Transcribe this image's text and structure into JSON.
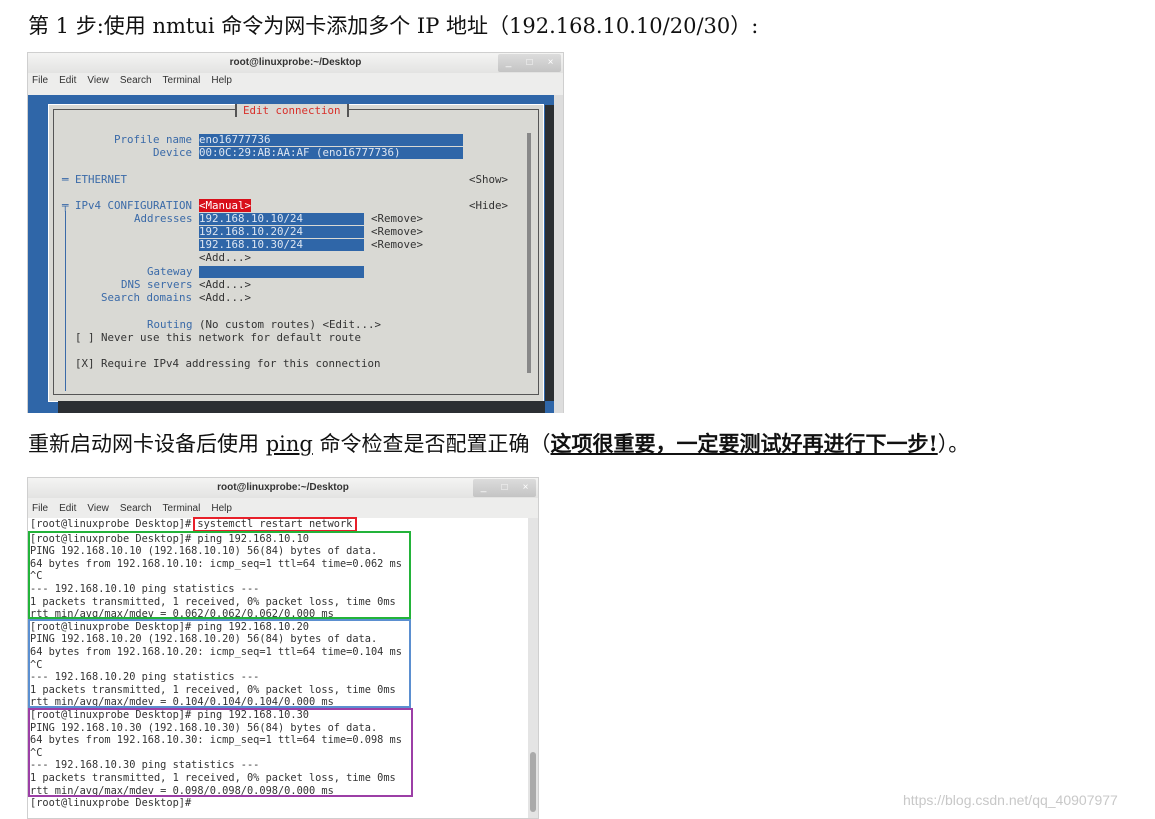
{
  "heading1": "第 1 步:使用 nmtui 命令为网卡添加多个 IP 地址（192.168.10.10/20/30）:",
  "para2": {
    "prefix": "重新启动网卡设备后使用 ",
    "ping": "ping",
    "middle": " 命令检查是否配置正确（",
    "emph": "这项很重要，一定要测试好再进行下一步!",
    "suffix": "）。"
  },
  "window1": {
    "title": "root@linuxprobe:~/Desktop",
    "menu": [
      "File",
      "Edit",
      "View",
      "Search",
      "Terminal",
      "Help"
    ],
    "dialog_title": "Edit connection",
    "profile_label": "Profile name",
    "profile_value": "eno16777736",
    "device_label": "Device",
    "device_value": "00:0C:29:AB:AA:AF (eno16777736)",
    "ethernet": "═ ETHERNET",
    "show": "<Show>",
    "ipv4": "╤ IPv4 CONFIGURATION",
    "ipv4_mode": "<Manual>",
    "hide": "<Hide>",
    "addresses_label": "Addresses",
    "addresses": [
      "192.168.10.10/24",
      "192.168.10.20/24",
      "192.168.10.30/24"
    ],
    "remove": "<Remove>",
    "add": "<Add...>",
    "gateway_label": "Gateway",
    "dns_label": "DNS servers",
    "search_label": "Search domains",
    "routing_label": "Routing",
    "routing_value": "(No custom routes) <Edit...>",
    "never_default": "[ ] Never use this network for default route",
    "require_ipv4": "[X] Require IPv4 addressing for this connection"
  },
  "window2": {
    "title": "root@linuxprobe:~/Desktop",
    "menu": [
      "File",
      "Edit",
      "View",
      "Search",
      "Terminal",
      "Help"
    ],
    "prompt": "[root@linuxprobe Desktop]# ",
    "restart_cmd": "systemctl restart network",
    "lines": [
      "[root@linuxprobe Desktop]# ping 192.168.10.10",
      "PING 192.168.10.10 (192.168.10.10) 56(84) bytes of data.",
      "64 bytes from 192.168.10.10: icmp_seq=1 ttl=64 time=0.062 ms",
      "^C",
      "--- 192.168.10.10 ping statistics ---",
      "1 packets transmitted, 1 received, 0% packet loss, time 0ms",
      "rtt min/avg/max/mdev = 0.062/0.062/0.062/0.000 ms",
      "[root@linuxprobe Desktop]# ping 192.168.10.20",
      "PING 192.168.10.20 (192.168.10.20) 56(84) bytes of data.",
      "64 bytes from 192.168.10.20: icmp_seq=1 ttl=64 time=0.104 ms",
      "^C",
      "--- 192.168.10.20 ping statistics ---",
      "1 packets transmitted, 1 received, 0% packet loss, time 0ms",
      "rtt min/avg/max/mdev = 0.104/0.104/0.104/0.000 ms",
      "[root@linuxprobe Desktop]# ping 192.168.10.30",
      "PING 192.168.10.30 (192.168.10.30) 56(84) bytes of data.",
      "64 bytes from 192.168.10.30: icmp_seq=1 ttl=64 time=0.098 ms",
      "^C",
      "--- 192.168.10.30 ping statistics ---",
      "1 packets transmitted, 1 received, 0% packet loss, time 0ms",
      "rtt min/avg/max/mdev = 0.098/0.098/0.098/0.000 ms",
      "[root@linuxprobe Desktop]#"
    ],
    "highlight_colors": {
      "restart": "#e8202a",
      "ping10": "#23b33a",
      "ping20": "#5b8fd0",
      "ping30": "#9c3fa6"
    }
  },
  "watermark": "https://blog.csdn.net/qq_40907977"
}
